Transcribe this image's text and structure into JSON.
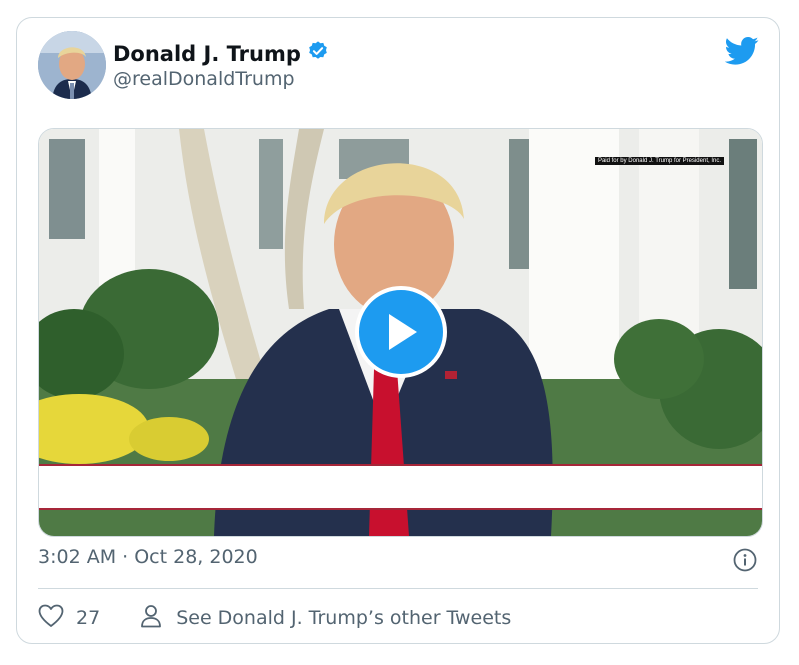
{
  "author": {
    "name": "Donald J. Trump",
    "handle": "@realDonaldTrump",
    "verified": true,
    "avatar_icon": "profile-photo"
  },
  "brand": {
    "icon": "twitter-bird-icon",
    "color": "#1d9bf0"
  },
  "media": {
    "overlay_text": "Paid for by Donald J. Trump for President, Inc.",
    "play_icon": "play-icon",
    "accent_color": "#a62639"
  },
  "tweet": {
    "timestamp": "3:02 AM · Oct 28, 2020"
  },
  "actions": {
    "likes": "27",
    "like_icon": "heart-icon",
    "other_tweets": "See Donald J. Trump’s other Tweets",
    "other_icon": "person-icon",
    "info_icon": "info-icon"
  }
}
